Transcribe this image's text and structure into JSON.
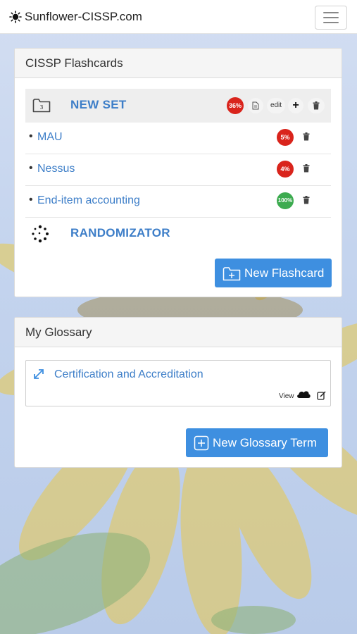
{
  "navbar": {
    "brand": "Sunflower-CISSP.com",
    "logo_icon": "sunflower-logo-icon",
    "menu_icon": "hamburger-menu-icon"
  },
  "flashcards": {
    "heading": "CISSP Flashcards",
    "set": {
      "count": "3",
      "title": "NEW SET",
      "progress": "36%",
      "progress_color": "#d9241c",
      "edit_label": "edit",
      "add_label": "+"
    },
    "items": [
      {
        "label": "MAU",
        "progress": "5%",
        "progress_color": "#d9241c"
      },
      {
        "label": "Nessus",
        "progress": "4%",
        "progress_color": "#d9241c"
      },
      {
        "label": "End-item accounting",
        "progress": "100%",
        "progress_color": "#3cab4f"
      }
    ],
    "bullet": "•",
    "randomizer": "RANDOMIZATOR",
    "new_button": "New Flashcard"
  },
  "glossary": {
    "heading": "My Glossary",
    "term": "Certification and Accreditation",
    "view_label": "View",
    "new_button": "New Glossary Term"
  },
  "colors": {
    "link": "#3d7ec8",
    "primary": "#3e8fe0"
  }
}
